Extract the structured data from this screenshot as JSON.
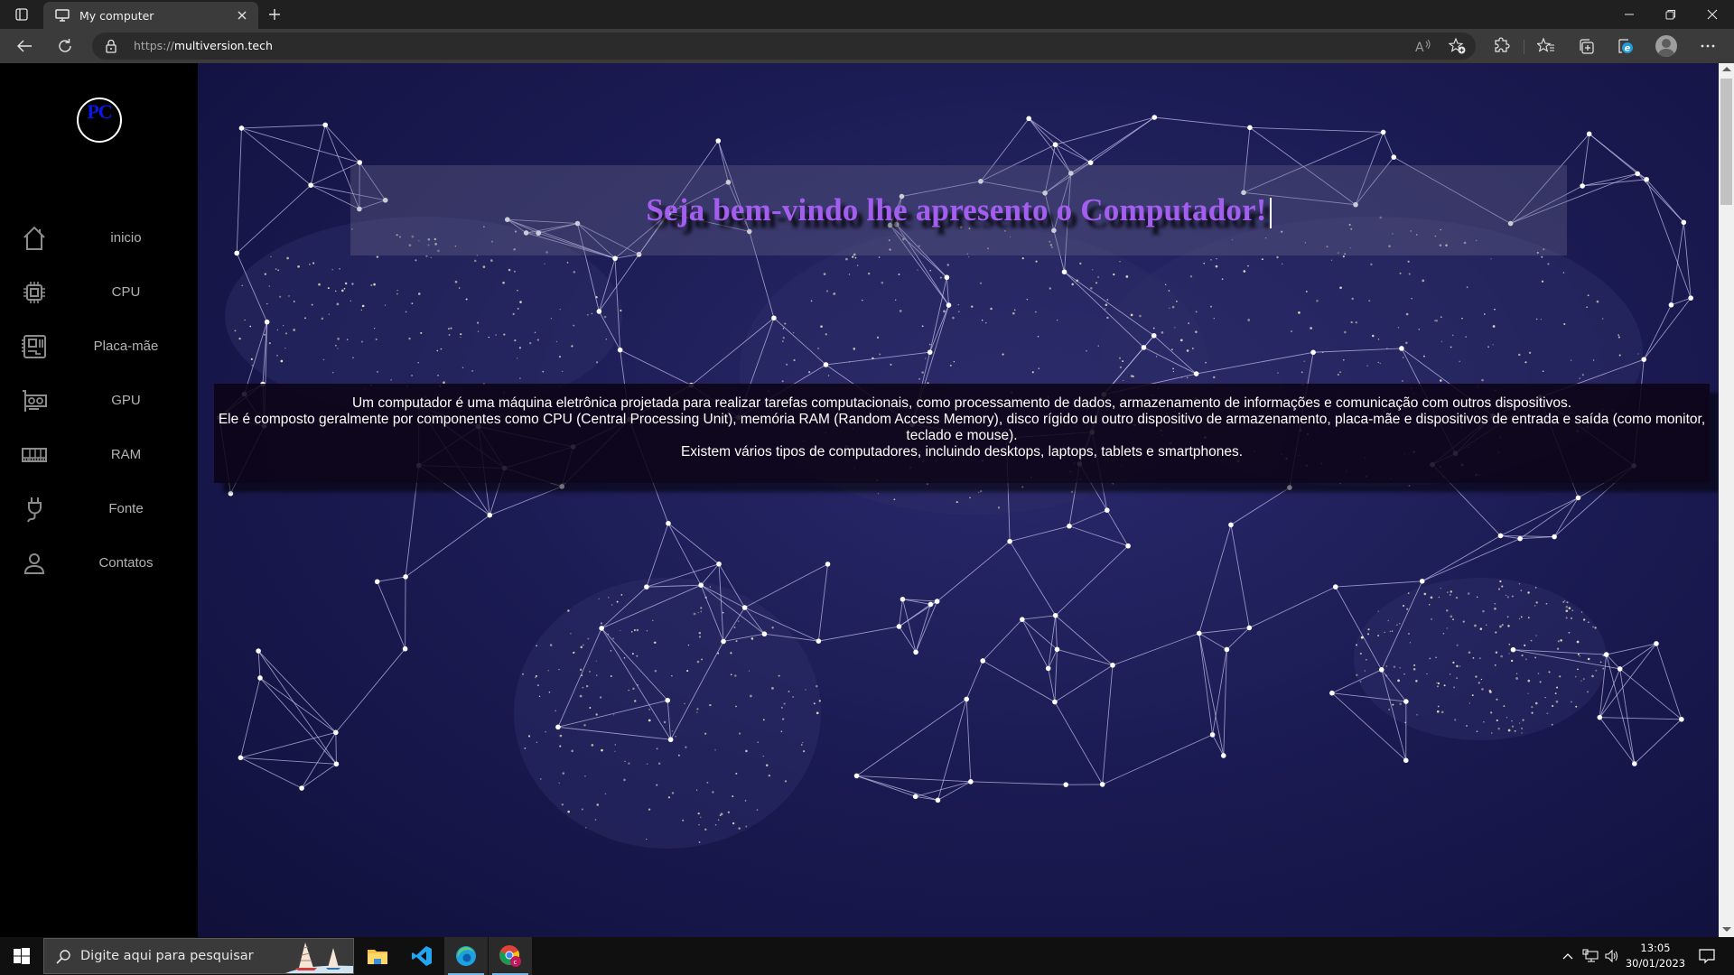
{
  "browser": {
    "tab_title": "My computer",
    "url_scheme": "https://",
    "url_host": "multiversion.tech",
    "icons": {
      "tab_actions": "tab-actions-icon",
      "favicon": "monitor-icon",
      "close_tab": "close-icon",
      "new_tab": "plus-icon",
      "minimize": "minimize-icon",
      "restore": "restore-icon",
      "close_window": "close-icon",
      "back": "back-arrow-icon",
      "refresh": "refresh-icon",
      "lock": "lock-icon",
      "read_aloud": "read-aloud-icon",
      "add_favorite": "star-plus-icon",
      "extensions": "puzzle-icon",
      "favorites": "favorites-list-icon",
      "collections": "collections-icon",
      "ie_mode": "ie-icon",
      "profile": "profile-avatar",
      "more": "more-icon"
    }
  },
  "page": {
    "logo_text": "PC",
    "sidebar": {
      "items": [
        {
          "label": "inicio",
          "icon": "home-icon"
        },
        {
          "label": "CPU",
          "icon": "cpu-chip-icon"
        },
        {
          "label": "Placa-mãe",
          "icon": "motherboard-icon"
        },
        {
          "label": "GPU",
          "icon": "gpu-card-icon"
        },
        {
          "label": "RAM",
          "icon": "ram-module-icon"
        },
        {
          "label": "Fonte",
          "icon": "power-plug-icon"
        },
        {
          "label": "Contatos",
          "icon": "user-icon"
        }
      ]
    },
    "title": "Seja bem-vindo lhe apresento o Computador!",
    "description": [
      "Um computador é uma máquina eletrônica projetada para realizar tarefas computacionais, como processamento de dados, armazenamento de informações e comunicação com outros dispositivos.",
      "Ele é composto geralmente por componentes como CPU (Central Processing Unit), memória RAM (Random Access Memory), disco rígido ou outro dispositivo de armazenamento, placa-mãe e dispositivos de entrada e saída (como monitor, teclado e mouse).",
      "Existem vários tipos de computadores, incluindo desktops, laptops, tablets e smartphones."
    ],
    "colors": {
      "title": "#a35ef0",
      "logo_text": "#0a18e6",
      "sidebar_bg": "#000000",
      "sidebar_text": "#b3b3b3",
      "background": "#1c1c55"
    }
  },
  "taskbar": {
    "search_placeholder": "Digite aqui para pesquisar",
    "apps": [
      "file-explorer-icon",
      "vscode-icon",
      "edge-icon",
      "chrome-icon"
    ],
    "time": "13:05",
    "date": "30/01/2023"
  }
}
